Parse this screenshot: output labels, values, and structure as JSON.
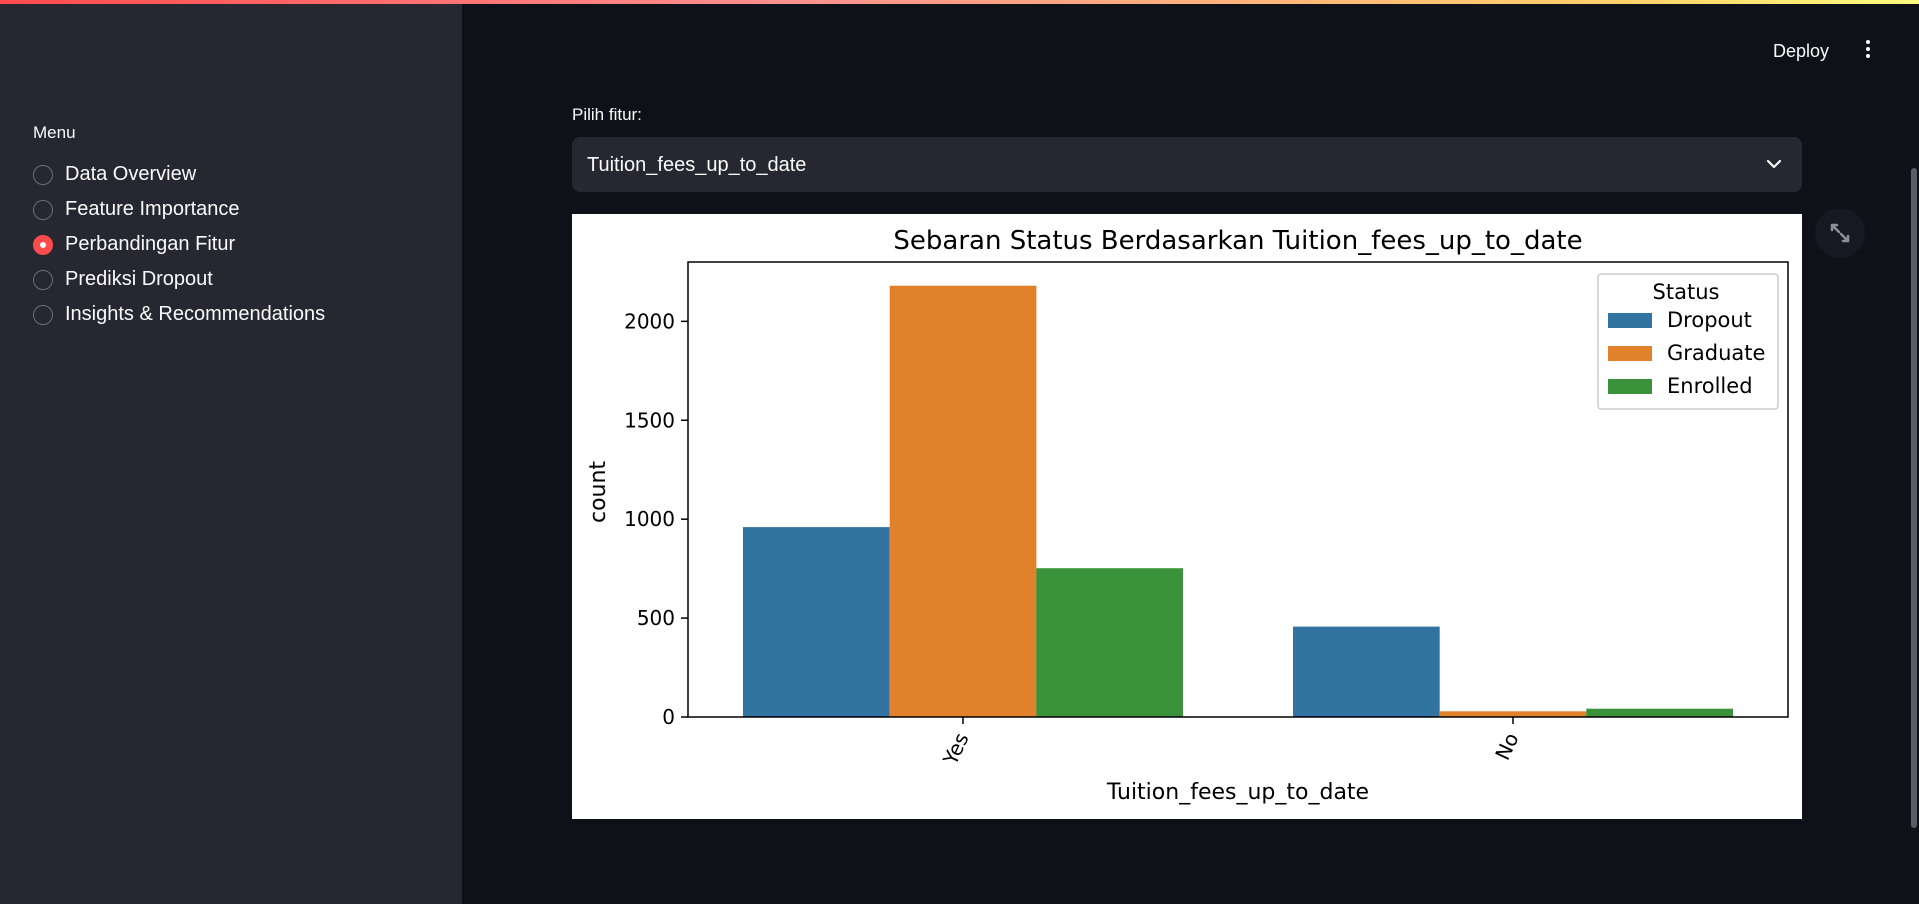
{
  "app": {
    "deploy_label": "Deploy"
  },
  "sidebar": {
    "menu_label": "Menu",
    "items": [
      {
        "label": "Data Overview",
        "selected": false
      },
      {
        "label": "Feature Importance",
        "selected": false
      },
      {
        "label": "Perbandingan Fitur",
        "selected": true
      },
      {
        "label": "Prediksi Dropout",
        "selected": false
      },
      {
        "label": "Insights & Recommendations",
        "selected": false
      }
    ]
  },
  "main": {
    "select_label": "Pilih fitur:",
    "select_value": "Tuition_fees_up_to_date"
  },
  "icons": {
    "menu": "kebab-menu-icon",
    "chevron": "chevron-down-icon",
    "expand": "fullscreen-expand-icon"
  },
  "colors": {
    "accent": "#ff4b4b",
    "Dropout": "#3274a1",
    "Graduate": "#e1812c",
    "Enrolled": "#3a923a"
  },
  "chart_data": {
    "type": "bar",
    "title": "Sebaran Status Berdasarkan Tuition_fees_up_to_date",
    "xlabel": "Tuition_fees_up_to_date",
    "ylabel": "count",
    "categories": [
      "Yes",
      "No"
    ],
    "series": [
      {
        "name": "Dropout",
        "values": [
          960,
          457
        ]
      },
      {
        "name": "Graduate",
        "values": [
          2180,
          29
        ]
      },
      {
        "name": "Enrolled",
        "values": [
          752,
          42
        ]
      }
    ],
    "ylim": [
      0,
      2300
    ],
    "yticks": [
      0,
      500,
      1000,
      1500,
      2000
    ],
    "legend_title": "Status",
    "legend_position": "top-right",
    "grid": false
  }
}
